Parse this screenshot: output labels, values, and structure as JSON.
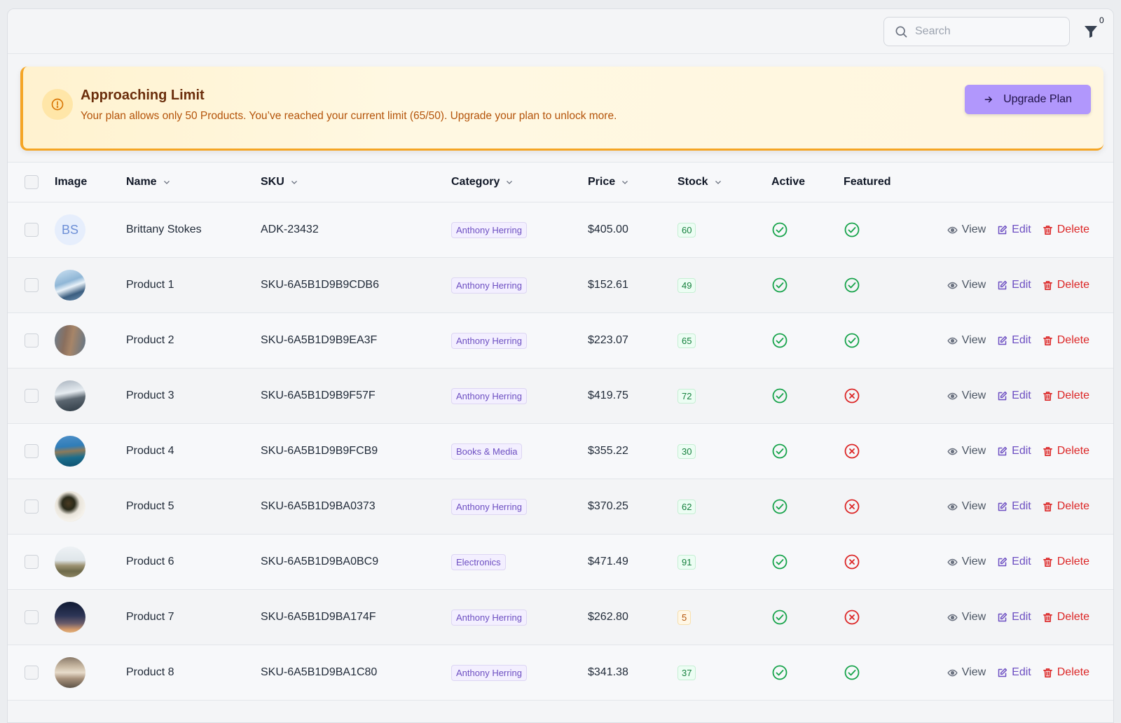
{
  "search": {
    "placeholder": "Search"
  },
  "filter": {
    "count": "0"
  },
  "banner": {
    "title": "Approaching Limit",
    "message": "Your plan allows only 50 Products. You’ve reached your current limit (65/50). Upgrade your plan to unlock more.",
    "button_label": "Upgrade Plan"
  },
  "table": {
    "columns": {
      "image": "Image",
      "name": "Name",
      "sku": "SKU",
      "category": "Category",
      "price": "Price",
      "stock": "Stock",
      "active": "Active",
      "featured": "Featured"
    },
    "actions": {
      "view": "View",
      "edit": "Edit",
      "delete": "Delete"
    },
    "rows": [
      {
        "image": "initials",
        "initials": "BS",
        "name": "Brittany Stokes",
        "sku": "ADK-23432",
        "category": "Anthony Herring",
        "price": "$405.00",
        "stock": "60",
        "active": true,
        "featured": true
      },
      {
        "image": "photo-aircraft-wing",
        "name": "Product 1",
        "sku": "SKU-6A5B1D9B9CDB6",
        "category": "Anthony Herring",
        "price": "$152.61",
        "stock": "49",
        "active": true,
        "featured": true
      },
      {
        "image": "photo-flatiron-building",
        "name": "Product 2",
        "sku": "SKU-6A5B1D9B9EA3F",
        "category": "Anthony Herring",
        "price": "$223.07",
        "stock": "65",
        "active": true,
        "featured": true
      },
      {
        "image": "photo-snowy-mountains",
        "name": "Product 3",
        "sku": "SKU-6A5B1D9B9F57F",
        "category": "Anthony Herring",
        "price": "$419.75",
        "stock": "72",
        "active": true,
        "featured": false
      },
      {
        "image": "photo-coastal-cliffs",
        "name": "Product 4",
        "sku": "SKU-6A5B1D9B9FCB9",
        "category": "Books & Media",
        "price": "$355.22",
        "stock": "30",
        "active": true,
        "featured": false
      },
      {
        "image": "photo-food-bowl",
        "name": "Product 5",
        "sku": "SKU-6A5B1D9BA0373",
        "category": "Anthony Herring",
        "price": "$370.25",
        "stock": "62",
        "active": true,
        "featured": false
      },
      {
        "image": "photo-grassland",
        "name": "Product 6",
        "sku": "SKU-6A5B1D9BA0BC9",
        "category": "Electronics",
        "price": "$471.49",
        "stock": "91",
        "active": true,
        "featured": false
      },
      {
        "image": "photo-dusk-sky",
        "name": "Product 7",
        "sku": "SKU-6A5B1D9BA174F",
        "category": "Anthony Herring",
        "price": "$262.80",
        "stock": "5",
        "active": true,
        "featured": false
      },
      {
        "image": "photo-cloudy-landscape",
        "name": "Product 8",
        "sku": "SKU-6A5B1D9BA1C80",
        "category": "Anthony Herring",
        "price": "$341.38",
        "stock": "37",
        "active": true,
        "featured": true
      }
    ]
  },
  "colors": {
    "accent": "#b197fc",
    "warning": "#f5a524",
    "success": "#16a34a",
    "danger": "#dc2626",
    "category": "#6d4fc2"
  }
}
